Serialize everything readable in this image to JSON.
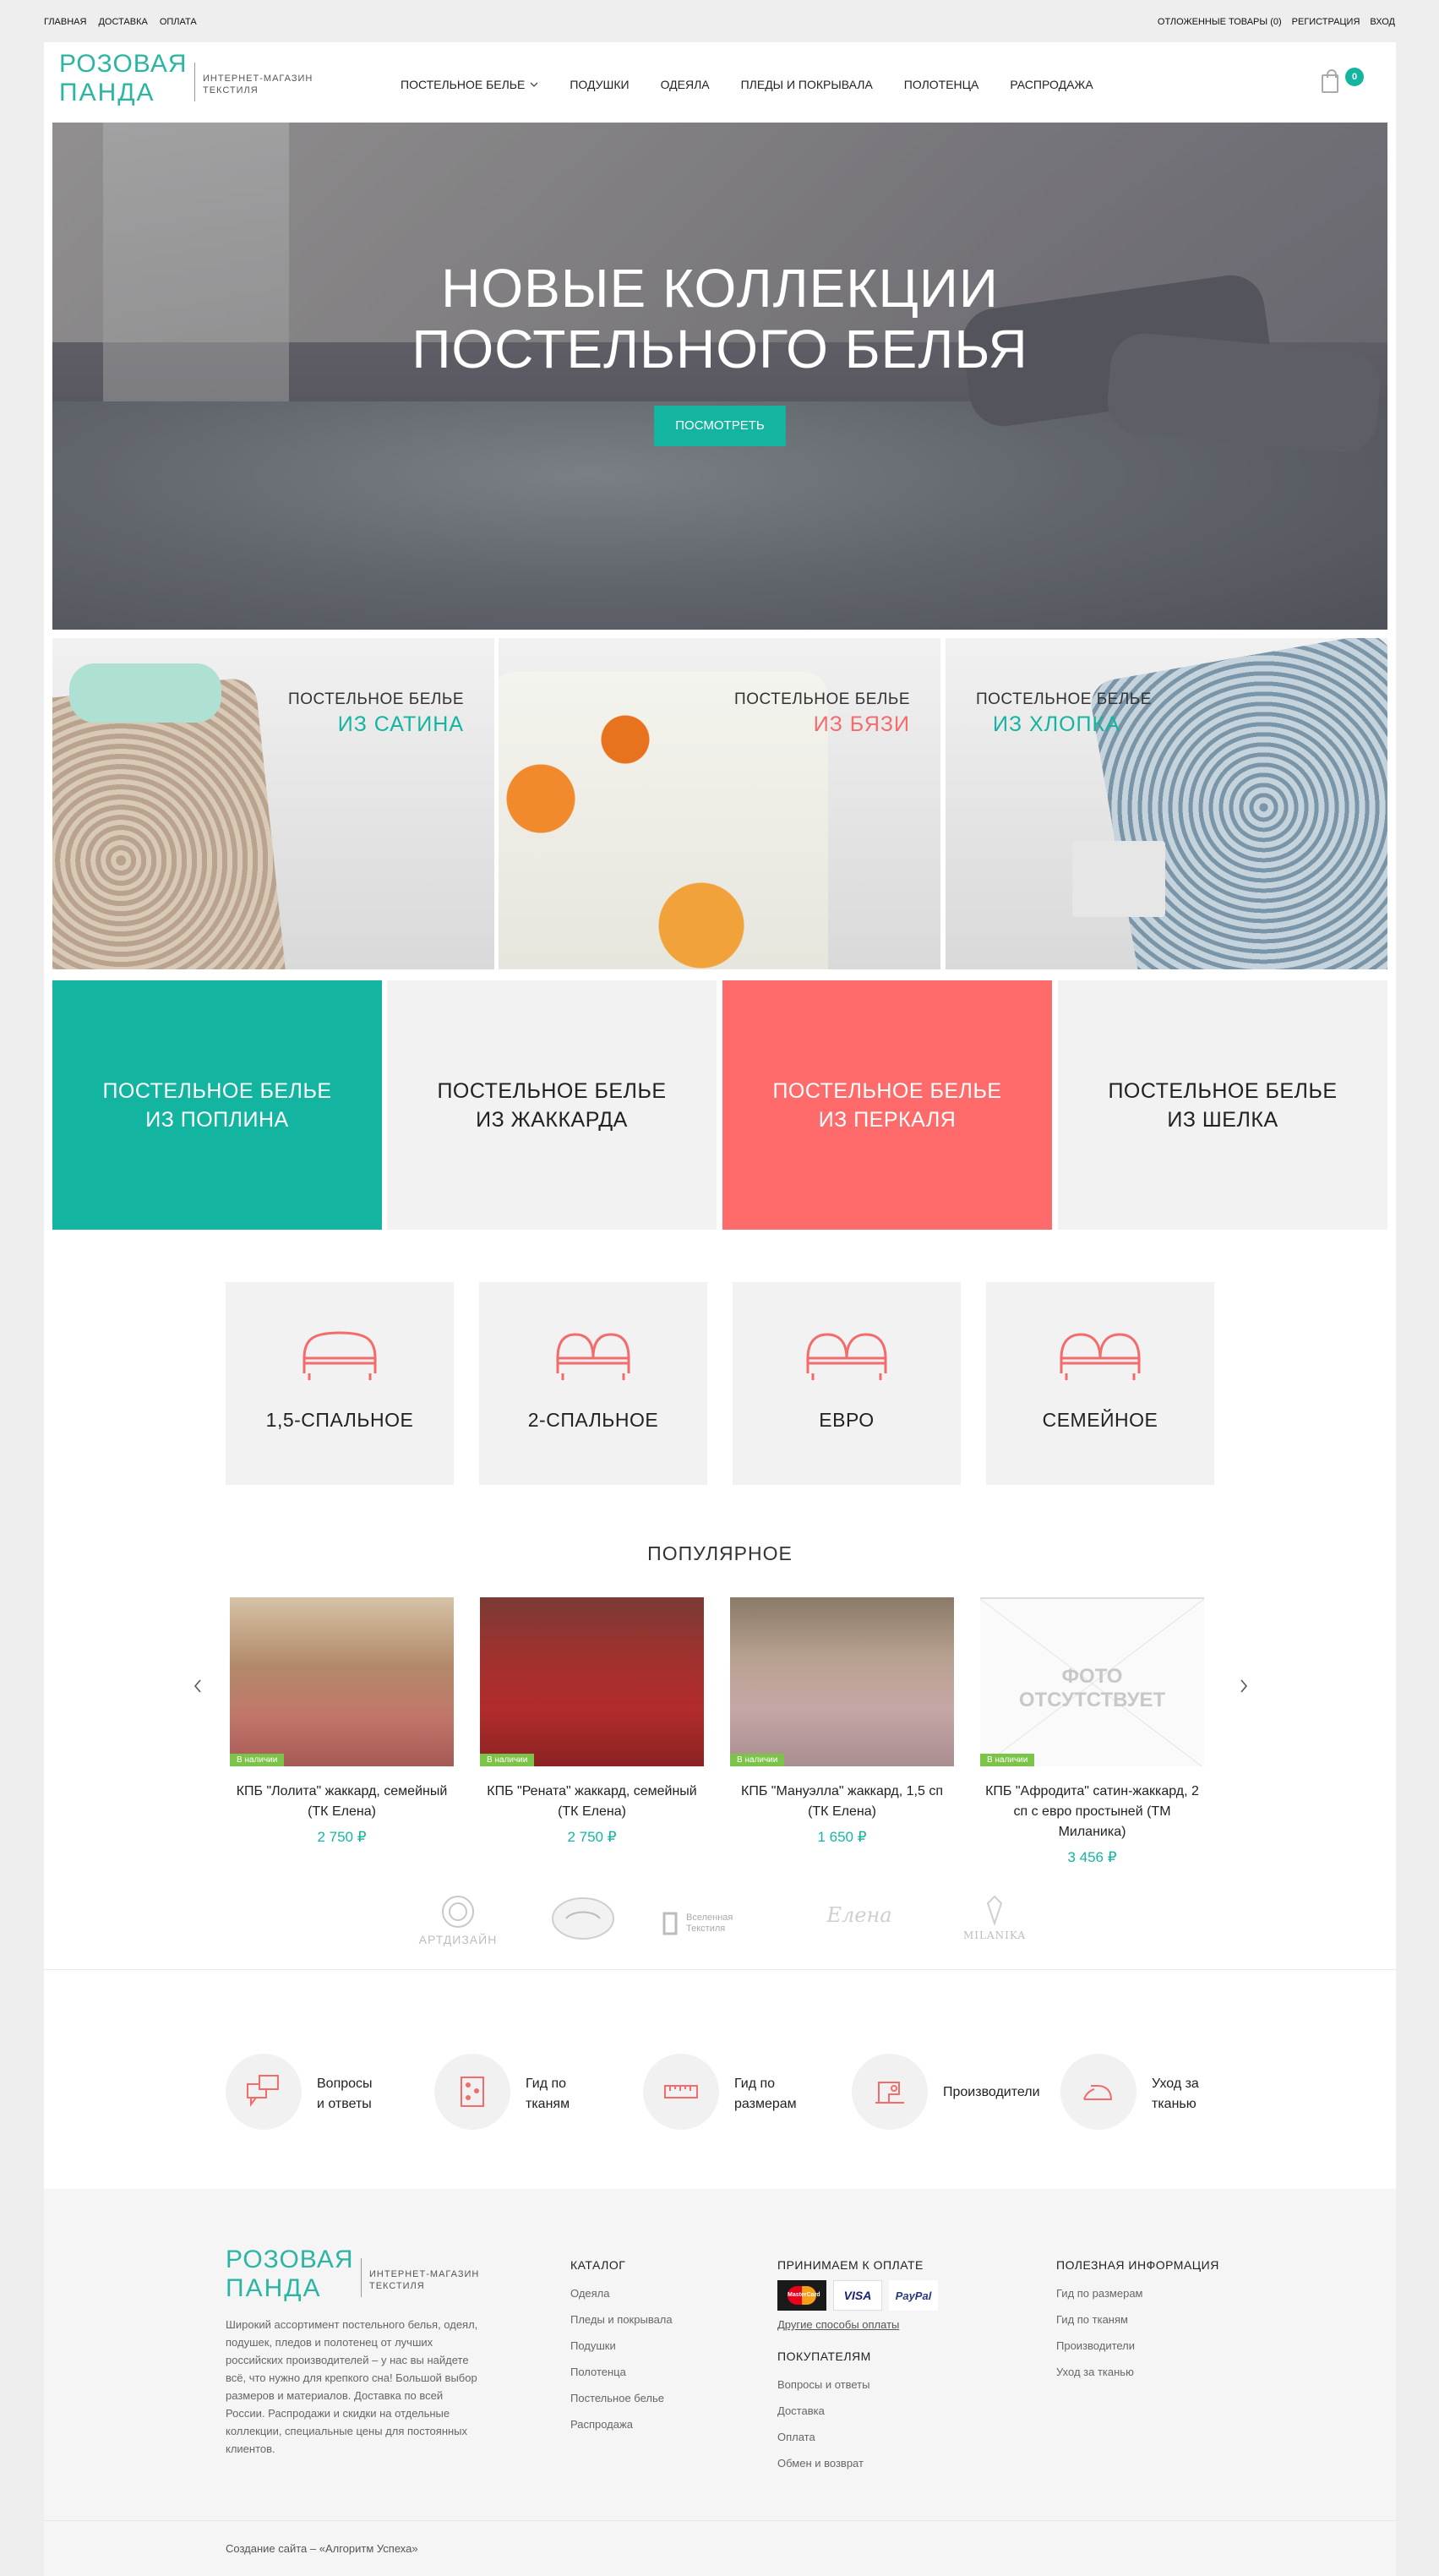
{
  "topbar": {
    "left": [
      "ГЛАВНАЯ",
      "ДОСТАВКА",
      "ОПЛАТА"
    ],
    "right": [
      "ОТЛОЖЕННЫЕ ТОВАРЫ (0)",
      "РЕГИСТРАЦИЯ",
      "ВХОД"
    ]
  },
  "header": {
    "logo_line1": "РОЗОВАЯ",
    "logo_line2": "ПАНДА",
    "logo_sub": "ИНТЕРНЕТ-МАГАЗИН ТЕКСТИЛЯ",
    "nav": [
      "ПОСТЕЛЬНОЕ БЕЛЬЕ",
      "ПОДУШКИ",
      "ОДЕЯЛА",
      "ПЛЕДЫ И ПОКРЫВАЛА",
      "ПОЛОТЕНЦА",
      "РАСПРОДАЖА"
    ],
    "cart_count": "0"
  },
  "hero": {
    "title_line1": "НОВЫЕ КОЛЛЕКЦИИ",
    "title_line2": "ПОСТЕЛЬНОГО БЕЛЬЯ",
    "button": "ПОСМОТРЕТЬ"
  },
  "materials": [
    {
      "line1": "ПОСТЕЛЬНОЕ БЕЛЬЕ",
      "line2": "ИЗ САТИНА",
      "color": "#14b5a0"
    },
    {
      "line1": "ПОСТЕЛЬНОЕ БЕЛЬЕ",
      "line2": "ИЗ БЯЗИ",
      "color": "#f36b6b"
    },
    {
      "line1": "ПОСТЕЛЬНОЕ БЕЛЬЕ",
      "line2": "ИЗ ХЛОПКА",
      "color": "#14b5a0"
    }
  ],
  "tiles": [
    {
      "line1": "ПОСТЕЛЬНОЕ БЕЛЬЕ",
      "line2": "ИЗ ПОПЛИНА",
      "bg": "#14b5a0",
      "fg": "#ffffff"
    },
    {
      "line1": "ПОСТЕЛЬНОЕ БЕЛЬЕ",
      "line2": "ИЗ ЖАККАРДА",
      "bg": "#f2f2f2",
      "fg": "#222222"
    },
    {
      "line1": "ПОСТЕЛЬНОЕ БЕЛЬЕ",
      "line2": "ИЗ ПЕРКАЛЯ",
      "bg": "#ff6b6b",
      "fg": "#ffffff"
    },
    {
      "line1": "ПОСТЕЛЬНОЕ БЕЛЬЕ",
      "line2": "ИЗ ШЕЛКА",
      "bg": "#f2f2f2",
      "fg": "#222222"
    }
  ],
  "sizes": [
    "1,5-СПАЛЬНОЕ",
    "2-СПАЛЬНОЕ",
    "ЕВРО",
    "СЕМЕЙНОЕ"
  ],
  "popular": {
    "title": "ПОПУЛЯРНОЕ",
    "badge": "В наличии",
    "products": [
      {
        "name": "КПБ \"Лолита\" жаккард, семейный (ТК Елена)",
        "price": "2 750 ₽"
      },
      {
        "name": "КПБ \"Рената\" жаккард, семейный (ТК Елена)",
        "price": "2 750 ₽"
      },
      {
        "name": "КПБ \"Мануэлла\" жаккард, 1,5 сп (ТК Елена)",
        "price": "1 650 ₽"
      },
      {
        "name": "КПБ \"Афродита\" сатин-жаккард, 2 сп с евро простыней (ТМ Миланика)",
        "price": "3 456 ₽"
      }
    ],
    "no_photo_line1": "ФОТО",
    "no_photo_line2": "ОТСУТСТВУЕТ"
  },
  "brands": [
    "АРТДИЗАЙН",
    "Вселенная Текстиля",
    "Елена",
    "MILANIKA"
  ],
  "infos": [
    {
      "label1": "Вопросы",
      "label2": "и ответы",
      "icon": "chat-icon"
    },
    {
      "label1": "Гид по",
      "label2": "тканям",
      "icon": "fabric-icon"
    },
    {
      "label1": "Гид по",
      "label2": "размерам",
      "icon": "ruler-icon"
    },
    {
      "label1": "Производители",
      "label2": "",
      "icon": "sewing-machine-icon"
    },
    {
      "label1": "Уход за",
      "label2": "тканью",
      "icon": "iron-icon"
    }
  ],
  "footer": {
    "description": "Широкий ассортимент постельного белья, одеял, подушек, пледов и полотенец от лучших российских производителей – у нас вы найдете всё, что нужно для крепкого сна! Большой выбор размеров и материалов. Доставка по всей России. Распродажи и скидки на отдельные коллекции, специальные цены для постоянных клиентов.",
    "catalog_title": "КАТАЛОГ",
    "catalog": [
      "Одеяла",
      "Пледы и покрывала",
      "Подушки",
      "Полотенца",
      "Постельное белье",
      "Распродажа"
    ],
    "payment_title": "ПРИНИМАЕМ К ОПЛАТЕ",
    "cards": [
      "MasterCard",
      "VISA",
      "PayPal"
    ],
    "other_payment": "Другие способы оплаты",
    "buyers_title": "ПОКУПАТЕЛЯМ",
    "buyers": [
      "Вопросы и ответы",
      "Доставка",
      "Оплата",
      "Обмен и возврат"
    ],
    "useful_title": "ПОЛЕЗНАЯ ИНФОРМАЦИЯ",
    "useful": [
      "Гид по размерам",
      "Гид по тканям",
      "Производители",
      "Уход за тканью"
    ],
    "copyright": "Создание сайта – «Алгоритм Успеха»"
  },
  "colors": {
    "accent": "#14b5a0",
    "coral": "#ff6b6b"
  }
}
